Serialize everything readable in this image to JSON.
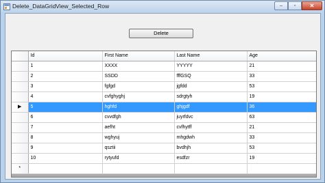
{
  "window": {
    "title": "Delete_DataGridView_Selected_Row",
    "minimize_glyph": "–",
    "maximize_glyph": "▫",
    "close_glyph": "✕"
  },
  "form": {
    "delete_label": "Delete"
  },
  "grid": {
    "columns": [
      "Id",
      "First Name",
      "Last Name",
      "Age"
    ],
    "selected_row_index": 4,
    "current_row_glyph": "▶",
    "new_row_glyph": "*",
    "rows": [
      {
        "id": "1",
        "first": "XXXX",
        "last": "YYYYY",
        "age": "21"
      },
      {
        "id": "2",
        "first": "SSDD",
        "last": "fffGSQ",
        "age": "33"
      },
      {
        "id": "3",
        "first": "fgfgd",
        "last": "jgfdd",
        "age": "53"
      },
      {
        "id": "4",
        "first": "cvfghyghj",
        "last": "sdrgtyh",
        "age": "19"
      },
      {
        "id": "5",
        "first": "hghfd",
        "last": "ghjgdf",
        "age": "36"
      },
      {
        "id": "6",
        "first": "cvvdfgh",
        "last": "juyrfdvc",
        "age": "63"
      },
      {
        "id": "7",
        "first": "aefht",
        "last": "cvfhytff",
        "age": "21"
      },
      {
        "id": "8",
        "first": "wghyuj",
        "last": "mhgdwh",
        "age": "33"
      },
      {
        "id": "9",
        "first": "qsztii",
        "last": "bvdhjh",
        "age": "53"
      },
      {
        "id": "10",
        "first": "rytyufd",
        "last": "esdfzr",
        "age": "19"
      }
    ]
  },
  "colors": {
    "selection": "#3399ff",
    "window_frame": "#b9d1ea",
    "grid_background": "#ababab"
  }
}
